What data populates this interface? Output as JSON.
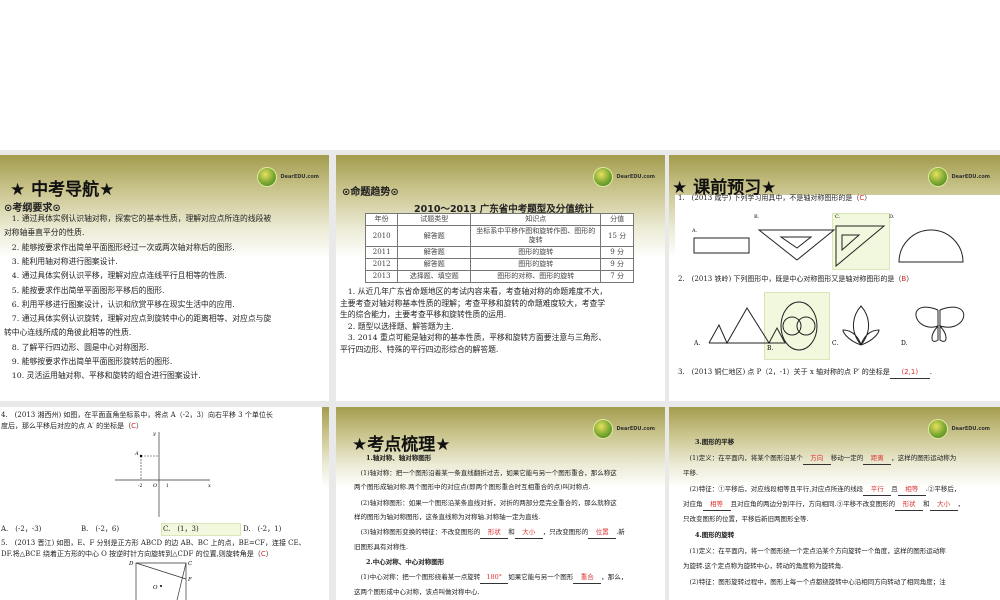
{
  "logo_text": "DearEDU.com",
  "slide1": {
    "title": "★ 中考导航★",
    "subtitle": "⊙考纲要求⊙",
    "lines": [
      "　1. 通过具体实例认识轴对称，探索它的基本性质，理解对应点所连的线段被",
      "对称轴垂直平分的性质.",
      "　2. 能够按要求作出简单平面图形经过一次或两次轴对称后的图形.",
      "　3. 能利用轴对称进行图案设计.",
      "　4. 通过具体实例认识平移，理解对应点连线平行且相等的性质.",
      "　5. 能按要求作出简单平面图形平移后的图形.",
      "　6. 利用平移进行图案设计，认识和欣赏平移在现实生活中的应用.",
      "　7. 通过具体实例认识旋转，理解对应点到旋转中心的距离相等、对应点与旋",
      "转中心连线所成的角彼此相等的性质.",
      "　8. 了解平行四边形、圆是中心对称图形.",
      "　9. 能够按要求作出简单平面图形旋转后的图形.",
      "　10. 灵活运用轴对称、平移和旋转的组合进行图案设计."
    ]
  },
  "slide2": {
    "subtitle": "⊙命题趋势⊙",
    "table_title": "2010～2013 广东省中考题型及分值统计",
    "headers": [
      "年份",
      "试题类型",
      "知识点",
      "分值"
    ],
    "rows": [
      [
        "2010",
        "解答题",
        "坐标系中平移作图和旋转作图、图形的旋转",
        "15 分"
      ],
      [
        "2011",
        "解答题",
        "图形的旋转",
        "9 分"
      ],
      [
        "2012",
        "解答题",
        "图形的旋转",
        "9 分"
      ],
      [
        "2013",
        "选择题、填空题",
        "图形的对称、图形的旋转",
        "7 分"
      ]
    ],
    "lines": [
      "　1. 从近几年广东省命题地区的考试内容来看，考查轴对称的命题难度不大，",
      "主要考查对轴对称基本性质的理解；考查平移和旋转的命题难度较大，考查学",
      "生的综合能力，主要考查平移和旋转性质的运用.",
      "　2. 题型以选择题、解答题为主.",
      "　3. 2014 重点可能是轴对称的基本性质，平移和旋转方面要注意与三角形、",
      "平行四边形、特殊的平行四边形综合的解答题."
    ]
  },
  "slide3": {
    "title": "★ 课前预习★",
    "q1": "1.　(2013 咸宁) 下列学习用具中，不是轴对称图形的是（",
    "q1_answer": "C",
    "q1_end": "）",
    "q1_options": [
      "A.",
      "B.",
      "C.",
      "D."
    ],
    "q2": "2.　(2013 铁岭) 下列图形中，既是中心对称图形又是轴对称图形的是（",
    "q2_answer": "B",
    "q2_end": "）",
    "q2_options": [
      "A.",
      "B.",
      "C.",
      "D."
    ],
    "q3": "3.　(2013 铜仁地区) 点 P（2，-1）关于 x 轴对称的点 P′ 的坐标是",
    "q3_answer": "(2,1)",
    "q3_end": "."
  },
  "slide4": {
    "q4_l1": "4.　(2013 湘西州) 如图，在平面直角坐标系中，将点 A（-2，3）向右平移 3 个单位长",
    "q4_l2": "度后，那么平移后对应的点 A′ 的坐标是（",
    "q4_answer": "C",
    "q4_end": "）",
    "graph": {
      "y": "y",
      "x": "x",
      "o": "O",
      "a": "A",
      "neg2": "-2",
      "one": "1"
    },
    "options": [
      "A.　(-2，-3)",
      "B.　(-2，6)",
      "C.　(1，3)",
      "D.　(-2，1)"
    ],
    "q5_l1": "5.　(2013 晋江) 如图，E、F 分别是正方形 ABCD 的边 AB、BC 上的点，BE=CF，连接 CE、",
    "q5_l2": "DF.将△BCE 绕着正方形的中心 O 按逆时针方向旋转到△CDF 的位置,则旋转角是（",
    "q5_answer": "C",
    "q5_end": "）",
    "fig": {
      "d": "D",
      "c": "C",
      "f": "F",
      "o": "O"
    }
  },
  "slide5": {
    "title": "★考点梳理★",
    "h1": "1.轴对称、轴对称图形",
    "p1a": "　(1)轴对称：把一个图形沿着某一条直线翻折过去，如果它能与另一个图形重合，那么称这",
    "p1b": "两个图形成轴对称.两个图形中的对应点(即两个图形重合时互相重合的点)叫对称点.",
    "p2a": "　(2)轴对称图形：如果一个图形沿某条直线对折，对折的两部分是完全重合的，那么就称这",
    "p2b": "样的图形为轴对称图形，这条直线称为对称轴.对称轴一定为直线.",
    "p3a": "　(3)轴对称图形变换的特征：不改变图形的",
    "b1": "形状",
    "and": "和",
    "b2": "大小",
    "p3m": "，只改变图形的",
    "b3": "位置",
    "p3e": ".新",
    "p3b": "旧图形具有对称性.",
    "h2": "2.中心对称、中心对称图形",
    "p4a": "　(1)中心对称：把一个图形绕着某一点旋转",
    "b4": "180°",
    "p4m": "如果它能与另一个图形",
    "b5": "重合",
    "p4e": "，那么，",
    "p4b": "这两个图形成中心对称，该点叫做对称中心."
  },
  "slide6": {
    "h3": "3.图形的平移",
    "d1a": "　(1)定义：在平面内，将某个图形沿某个",
    "b1": "方向",
    "d1m": "移动一定的",
    "b2": "距离",
    "d1e": "，这样的图形运动称为",
    "d1b": "平移.",
    "f1": "　(2)特征：①平移后，对应线段相等且平行,对应点所连的线段",
    "b3": "平行",
    "qie": "且",
    "b4": "相等",
    "f1e": ".②平移后，",
    "f2": "对应角",
    "b5": "相等",
    "f2m": "且对应角的两边分别平行，方向相同.③平移不改变图形的",
    "b6": "形状",
    "he": "和",
    "b7": "大小",
    "f2e": "，",
    "f3": "只改变图形的位置，平移后新旧两图形全等.",
    "h4": "4.图形的旋转",
    "r1a": "　(1)定义：在平面内，将一个图形绕一个定点沿某个方向旋转一个角度，这样的图形运动称",
    "r1b": "为旋转.这个定点称为旋转中心，转动的角度称为旋转角.",
    "r2": "　(2)特征：图形旋转过程中，图形上每一个点都绕旋转中心沿相同方向转动了相同角度；注"
  }
}
